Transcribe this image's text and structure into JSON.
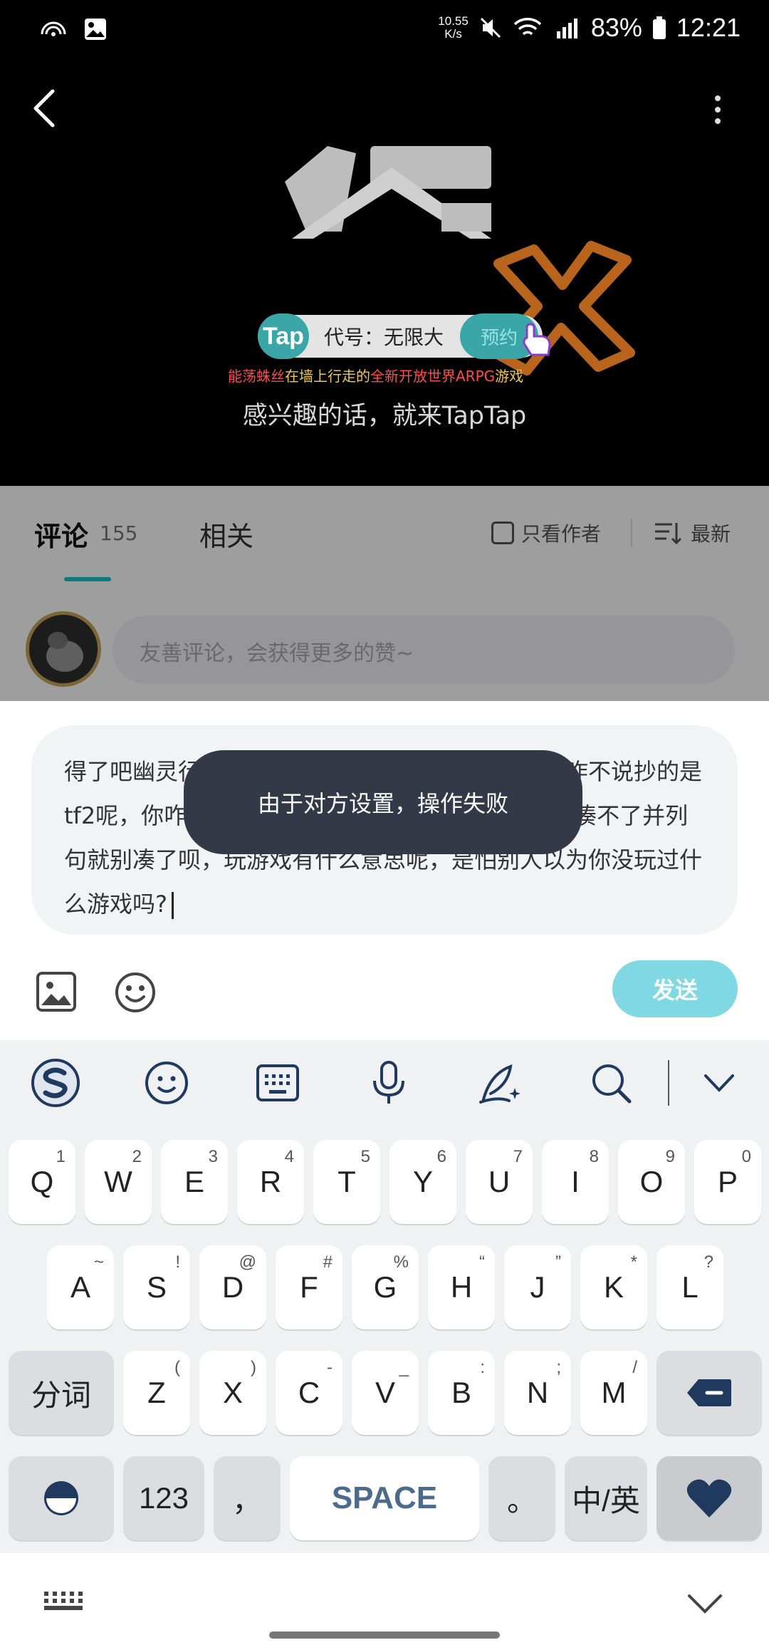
{
  "status_bar": {
    "speed": "10.55\nK/s",
    "battery": "83%",
    "time": "12:21",
    "network": "4G"
  },
  "video": {
    "game_title": "代号：无限大",
    "tap_brand": "Tap",
    "reserve_label": "预约",
    "slogan_parts": [
      "能荡蛛丝",
      "在墙上行走的",
      "全新开放世界ARPG",
      "游戏"
    ],
    "cta": "感兴趣的话，就来TapTap"
  },
  "tabs": {
    "comments_label": "评论",
    "comments_count": "155",
    "related_label": "相关",
    "author_only_label": "只看作者",
    "sort_label": "最新"
  },
  "comment_input": {
    "placeholder": "友善评论，会获得更多的赞~"
  },
  "reply": {
    "text": "得了吧幽灵行者，害一人都还来凑热闹了是吧，你咋不说抄的是tf2呢，你咋不说你咋不说你咋不说，如果你会的你凑不了并列句就别凑了呗，玩游戏有什么意思呢，是怕别人以为你没玩过什么游戏吗?",
    "send_label": "发送"
  },
  "toast": {
    "message": "由于对方设置，操作失败"
  },
  "keyboard": {
    "toolbar_icons": [
      "swiftkey-logo-icon",
      "emoji-icon",
      "keyboard-layout-icon",
      "microphone-icon",
      "handwriting-icon",
      "search-icon",
      "collapse-icon"
    ],
    "row1": [
      {
        "key": "Q",
        "sub": "1"
      },
      {
        "key": "W",
        "sub": "2"
      },
      {
        "key": "E",
        "sub": "3"
      },
      {
        "key": "R",
        "sub": "4"
      },
      {
        "key": "T",
        "sub": "5"
      },
      {
        "key": "Y",
        "sub": "6"
      },
      {
        "key": "U",
        "sub": "7"
      },
      {
        "key": "I",
        "sub": "8"
      },
      {
        "key": "O",
        "sub": "9"
      },
      {
        "key": "P",
        "sub": "0"
      }
    ],
    "row2": [
      {
        "key": "A",
        "sub": "~"
      },
      {
        "key": "S",
        "sub": "!"
      },
      {
        "key": "D",
        "sub": "@"
      },
      {
        "key": "F",
        "sub": "#"
      },
      {
        "key": "G",
        "sub": "%"
      },
      {
        "key": "H",
        "sub": "“"
      },
      {
        "key": "J",
        "sub": "”"
      },
      {
        "key": "K",
        "sub": "*"
      },
      {
        "key": "L",
        "sub": "?"
      }
    ],
    "row3": [
      {
        "key": "Z",
        "sub": "("
      },
      {
        "key": "X",
        "sub": ")"
      },
      {
        "key": "C",
        "sub": "-"
      },
      {
        "key": "V",
        "sub": "_"
      },
      {
        "key": "B",
        "sub": ":"
      },
      {
        "key": "N",
        "sub": ";"
      },
      {
        "key": "M",
        "sub": "/"
      }
    ],
    "segment_label": "分词",
    "num_label": "123",
    "comma_label": "，",
    "space_label": "SPACE",
    "period_label": "。",
    "lang_label": "中/英"
  },
  "colors": {
    "accent": "#15c5ce",
    "send_button": "#7fd8e2",
    "toast_bg": "#343947",
    "brand_heart": "#1f3a5e"
  }
}
